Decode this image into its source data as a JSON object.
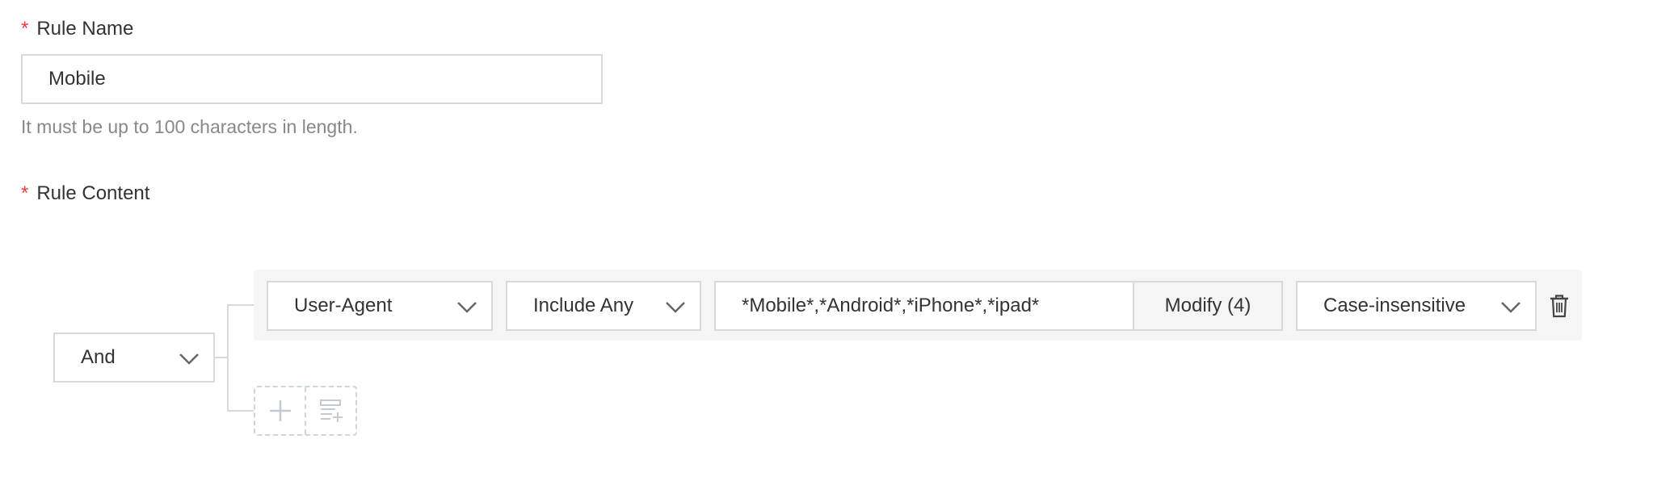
{
  "form": {
    "rule_name": {
      "required_mark": "*",
      "label": "Rule Name",
      "value": "Mobile",
      "help": "It must be up to 100 characters in length."
    },
    "rule_content": {
      "required_mark": "*",
      "label": "Rule Content",
      "logic_operator": "And",
      "condition": {
        "field": "User-Agent",
        "operator": "Include Any",
        "value": "*Mobile*,*Android*,*iPhone*,*ipad*",
        "modify_label": "Modify (4)",
        "case_mode": "Case-insensitive"
      }
    }
  },
  "icons": {
    "chevron": "chevron-down-icon",
    "delete": "trash-icon",
    "add_condition": "plus-icon",
    "add_group": "add-list-icon"
  },
  "colors": {
    "required": "#e5403a",
    "border": "#d9d9d9",
    "row_background": "#f5f5f5",
    "help_text": "#888888",
    "dashed": "#cfd5de"
  }
}
